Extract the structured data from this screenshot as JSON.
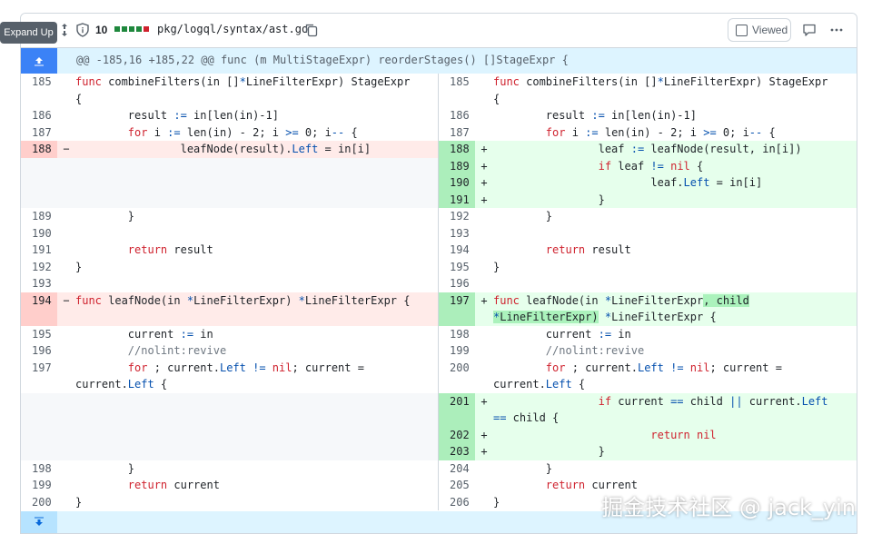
{
  "tooltip": "Expand Up",
  "header": {
    "changes_count": "10",
    "path": "pkg/logql/syntax/ast.go",
    "viewed_label": "Viewed"
  },
  "hunk": "@@ -185,16 +185,22 @@ func (m MultiStageExpr) reorderStages() []StageExpr {",
  "rows": [
    {
      "lnum": "185",
      "lsign": "",
      "lcode": "func combineFilters(in []*LineFilterExpr) StageExpr\n{",
      "ltype": "ctx",
      "rnum": "185",
      "rsign": "",
      "rcode": "func combineFilters(in []*LineFilterExpr) StageExpr\n{",
      "rtype": "ctx"
    },
    {
      "lnum": "186",
      "lsign": "",
      "lcode": "        result := in[len(in)-1]",
      "ltype": "ctx",
      "rnum": "186",
      "rsign": "",
      "rcode": "        result := in[len(in)-1]",
      "rtype": "ctx"
    },
    {
      "lnum": "187",
      "lsign": "",
      "lcode": "        for i := len(in) - 2; i >= 0; i-- {",
      "ltype": "ctx",
      "rnum": "187",
      "rsign": "",
      "rcode": "        for i := len(in) - 2; i >= 0; i-- {",
      "rtype": "ctx"
    },
    {
      "lnum": "188",
      "lsign": "−",
      "lcode": "                leafNode(result).Left = in[i]",
      "ltype": "del",
      "rnum": "188",
      "rsign": "+",
      "rcode": "                leaf := leafNode(result, in[i])",
      "rtype": "add"
    },
    {
      "lnum": "",
      "lsign": "",
      "lcode": "",
      "ltype": "empty",
      "rnum": "189",
      "rsign": "+",
      "rcode": "                if leaf != nil {",
      "rtype": "add"
    },
    {
      "lnum": "",
      "lsign": "",
      "lcode": "",
      "ltype": "empty",
      "rnum": "190",
      "rsign": "+",
      "rcode": "                        leaf.Left = in[i]",
      "rtype": "add"
    },
    {
      "lnum": "",
      "lsign": "",
      "lcode": "",
      "ltype": "empty",
      "rnum": "191",
      "rsign": "+",
      "rcode": "                }",
      "rtype": "add"
    },
    {
      "lnum": "189",
      "lsign": "",
      "lcode": "        }",
      "ltype": "ctx",
      "rnum": "192",
      "rsign": "",
      "rcode": "        }",
      "rtype": "ctx"
    },
    {
      "lnum": "190",
      "lsign": "",
      "lcode": "",
      "ltype": "ctx",
      "rnum": "193",
      "rsign": "",
      "rcode": "",
      "rtype": "ctx"
    },
    {
      "lnum": "191",
      "lsign": "",
      "lcode": "        return result",
      "ltype": "ctx",
      "rnum": "194",
      "rsign": "",
      "rcode": "        return result",
      "rtype": "ctx"
    },
    {
      "lnum": "192",
      "lsign": "",
      "lcode": "}",
      "ltype": "ctx",
      "rnum": "195",
      "rsign": "",
      "rcode": "}",
      "rtype": "ctx"
    },
    {
      "lnum": "193",
      "lsign": "",
      "lcode": "",
      "ltype": "ctx",
      "rnum": "196",
      "rsign": "",
      "rcode": "",
      "rtype": "ctx"
    },
    {
      "lnum": "194",
      "lsign": "−",
      "lcode": "func leafNode(in *LineFilterExpr) *LineFilterExpr {",
      "ltype": "del",
      "rnum": "197",
      "rsign": "+",
      "rcode": "func leafNode(in *LineFilterExpr, child\n*LineFilterExpr) *LineFilterExpr {",
      "rtype": "add"
    },
    {
      "lnum": "195",
      "lsign": "",
      "lcode": "        current := in",
      "ltype": "ctx",
      "rnum": "198",
      "rsign": "",
      "rcode": "        current := in",
      "rtype": "ctx"
    },
    {
      "lnum": "196",
      "lsign": "",
      "lcode": "        //nolint:revive",
      "ltype": "ctx",
      "rnum": "199",
      "rsign": "",
      "rcode": "        //nolint:revive",
      "rtype": "ctx"
    },
    {
      "lnum": "197",
      "lsign": "",
      "lcode": "        for ; current.Left != nil; current =\ncurrent.Left {",
      "ltype": "ctx",
      "rnum": "200",
      "rsign": "",
      "rcode": "        for ; current.Left != nil; current =\ncurrent.Left {",
      "rtype": "ctx"
    },
    {
      "lnum": "",
      "lsign": "",
      "lcode": "",
      "ltype": "empty",
      "rnum": "201",
      "rsign": "+",
      "rcode": "                if current == child || current.Left\n== child {",
      "rtype": "add"
    },
    {
      "lnum": "",
      "lsign": "",
      "lcode": "",
      "ltype": "empty",
      "rnum": "202",
      "rsign": "+",
      "rcode": "                        return nil",
      "rtype": "add"
    },
    {
      "lnum": "",
      "lsign": "",
      "lcode": "",
      "ltype": "empty",
      "rnum": "203",
      "rsign": "+",
      "rcode": "                }",
      "rtype": "add"
    },
    {
      "lnum": "198",
      "lsign": "",
      "lcode": "        }",
      "ltype": "ctx",
      "rnum": "204",
      "rsign": "",
      "rcode": "        }",
      "rtype": "ctx"
    },
    {
      "lnum": "199",
      "lsign": "",
      "lcode": "        return current",
      "ltype": "ctx",
      "rnum": "205",
      "rsign": "",
      "rcode": "        return current",
      "rtype": "ctx"
    },
    {
      "lnum": "200",
      "lsign": "",
      "lcode": "}",
      "ltype": "ctx",
      "rnum": "206",
      "rsign": "",
      "rcode": "}",
      "rtype": "ctx"
    }
  ],
  "watermark": "掘金技术社区 @ jack_yin"
}
